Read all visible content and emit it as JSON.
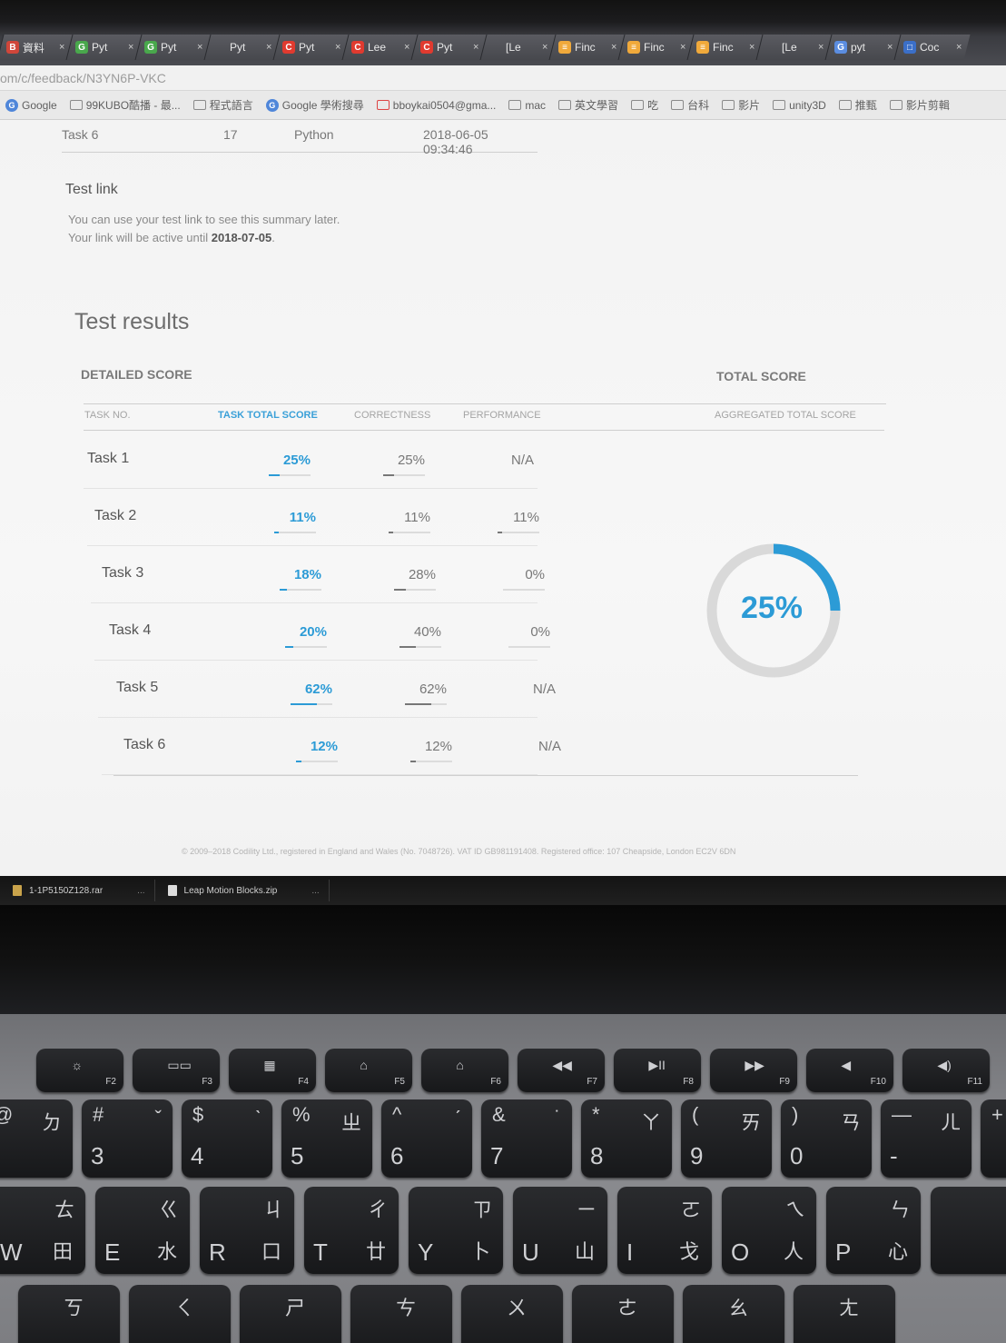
{
  "browser": {
    "tabs": [
      {
        "icon": "B",
        "color": "#d0463a",
        "label": "資料"
      },
      {
        "icon": "G",
        "color": "#49a84c",
        "label": "Pyt"
      },
      {
        "icon": "G",
        "color": "#49a84c",
        "label": "Pyt"
      },
      {
        "icon": "",
        "color": "transparent",
        "label": "Pyt"
      },
      {
        "icon": "C",
        "color": "#e03a2f",
        "label": "Pyt"
      },
      {
        "icon": "C",
        "color": "#e03a2f",
        "label": "Lee"
      },
      {
        "icon": "C",
        "color": "#e03a2f",
        "label": "Pyt"
      },
      {
        "icon": "",
        "color": "transparent",
        "label": "[Le"
      },
      {
        "icon": "≡",
        "color": "#f0a93b",
        "label": "Finc"
      },
      {
        "icon": "≡",
        "color": "#f0a93b",
        "label": "Finc"
      },
      {
        "icon": "≡",
        "color": "#f0a93b",
        "label": "Finc"
      },
      {
        "icon": "",
        "color": "transparent",
        "label": "[Le"
      },
      {
        "icon": "G",
        "color": "#5b8de0",
        "label": "pyt"
      },
      {
        "icon": "□",
        "color": "#3b6fc8",
        "label": "Coc"
      }
    ],
    "tab_close": "×",
    "url": "om/c/feedback/N3YN6P-VKC",
    "bookmarks": [
      {
        "label": "Google",
        "kind": "g"
      },
      {
        "label": "99KUBO酷播 - 最...",
        "kind": "f"
      },
      {
        "label": "程式語言",
        "kind": "f"
      },
      {
        "label": "Google 學術搜尋",
        "kind": "g"
      },
      {
        "label": "bboykai0504@gma...",
        "kind": "m"
      },
      {
        "label": "mac",
        "kind": "f"
      },
      {
        "label": "英文學習",
        "kind": "f"
      },
      {
        "label": "吃",
        "kind": "f"
      },
      {
        "label": "台科",
        "kind": "f"
      },
      {
        "label": "影片",
        "kind": "f"
      },
      {
        "label": "unity3D",
        "kind": "f"
      },
      {
        "label": "推甄",
        "kind": "f"
      },
      {
        "label": "影片剪輯",
        "kind": "f"
      }
    ]
  },
  "previous_row": {
    "task": "Task 6",
    "num": "17",
    "lang": "Python",
    "date": "2018-06-05 09:34:46"
  },
  "test_link": {
    "title": "Test link",
    "line1": "You can use your test link to see this summary later.",
    "line2_prefix": "Your link will be active until ",
    "line2_date": "2018-07-05",
    "line2_suffix": "."
  },
  "results": {
    "title": "Test results",
    "detailed_label": "DETAILED SCORE",
    "total_label": "TOTAL SCORE",
    "columns": {
      "task_no": "TASK NO.",
      "task_total": "TASK TOTAL SCORE",
      "correctness": "CORRECTNESS",
      "performance": "PERFORMANCE",
      "aggregated": "AGGREGATED TOTAL SCORE"
    },
    "rows": [
      {
        "task": "Task 1",
        "total": "25%",
        "total_frac": 0.25,
        "correctness": "25%",
        "corr_frac": 0.25,
        "performance": "N/A",
        "perf_frac": null
      },
      {
        "task": "Task 2",
        "total": "11%",
        "total_frac": 0.11,
        "correctness": "11%",
        "corr_frac": 0.11,
        "performance": "11%",
        "perf_frac": 0.11
      },
      {
        "task": "Task 3",
        "total": "18%",
        "total_frac": 0.18,
        "correctness": "28%",
        "corr_frac": 0.28,
        "performance": "0%",
        "perf_frac": 0
      },
      {
        "task": "Task 4",
        "total": "20%",
        "total_frac": 0.2,
        "correctness": "40%",
        "corr_frac": 0.4,
        "performance": "0%",
        "perf_frac": 0
      },
      {
        "task": "Task 5",
        "total": "62%",
        "total_frac": 0.62,
        "correctness": "62%",
        "corr_frac": 0.62,
        "performance": "N/A",
        "perf_frac": null
      },
      {
        "task": "Task 6",
        "total": "12%",
        "total_frac": 0.12,
        "correctness": "12%",
        "corr_frac": 0.12,
        "performance": "N/A",
        "perf_frac": null
      }
    ],
    "total_score": "25%",
    "total_score_frac": 0.25,
    "accent_color": "#2c9bd6"
  },
  "footer": "© 2009–2018 Codility Ltd., registered in England and Wales (No. 7048726). VAT ID GB981191408. Registered office: 107 Cheapside, London EC2V 6DN",
  "downloads": [
    {
      "name": "1-1P5150Z128.rar",
      "type": "archive"
    },
    {
      "name": "Leap Motion Blocks.zip",
      "type": "doc"
    }
  ],
  "downloads_more": "...",
  "keyboard": {
    "fn_row": [
      {
        "glyph": "☼",
        "label": "F2"
      },
      {
        "glyph": "▭▭",
        "label": "F3"
      },
      {
        "glyph": "▦",
        "label": "F4"
      },
      {
        "glyph": "⌂",
        "label": "F5"
      },
      {
        "glyph": "⌂",
        "label": "F6"
      },
      {
        "glyph": "◀◀",
        "label": "F7"
      },
      {
        "glyph": "▶II",
        "label": "F8"
      },
      {
        "glyph": "▶▶",
        "label": "F9"
      },
      {
        "glyph": "◀",
        "label": "F10"
      },
      {
        "glyph": "◀)",
        "label": "F11"
      }
    ],
    "num_row": [
      {
        "top": "@",
        "main": "",
        "zh": "ㄉ"
      },
      {
        "top": "#",
        "main": "3",
        "zh": "ˇ"
      },
      {
        "top": "$",
        "main": "4",
        "zh": "ˋ"
      },
      {
        "top": "%",
        "main": "5",
        "zh": "ㄓ"
      },
      {
        "top": "^",
        "main": "6",
        "zh": "ˊ"
      },
      {
        "top": "&",
        "main": "7",
        "zh": "˙"
      },
      {
        "top": "*",
        "main": "8",
        "zh": "ㄚ"
      },
      {
        "top": "(",
        "main": "9",
        "zh": "ㄞ"
      },
      {
        "top": ")",
        "main": "0",
        "zh": "ㄢ"
      },
      {
        "top": "—",
        "main": "-",
        "zh": "ㄦ"
      },
      {
        "top": "+",
        "main": "",
        "zh": ""
      }
    ],
    "letter_row": [
      {
        "main": "W",
        "zh": "ㄊ",
        "cj": "田"
      },
      {
        "main": "E",
        "zh": "ㄍ",
        "cj": "水"
      },
      {
        "main": "R",
        "zh": "ㄐ",
        "cj": "口"
      },
      {
        "main": "T",
        "zh": "ㄔ",
        "cj": "廿"
      },
      {
        "main": "Y",
        "zh": "ㄗ",
        "cj": "卜"
      },
      {
        "main": "U",
        "zh": "ㄧ",
        "cj": "山"
      },
      {
        "main": "I",
        "zh": "ㄛ",
        "cj": "戈"
      },
      {
        "main": "O",
        "zh": "ㄟ",
        "cj": "人"
      },
      {
        "main": "P",
        "zh": "ㄣ",
        "cj": "心"
      },
      {
        "main": "",
        "zh": "{",
        "cj": ""
      }
    ],
    "bottom_row": [
      {
        "zh": "ㄎ"
      },
      {
        "zh": "ㄑ"
      },
      {
        "zh": "ㄕ"
      },
      {
        "zh": "ㄘ"
      },
      {
        "zh": "ㄨ"
      },
      {
        "zh": "ㄜ"
      },
      {
        "zh": "ㄠ"
      },
      {
        "zh": "ㄤ"
      }
    ]
  }
}
